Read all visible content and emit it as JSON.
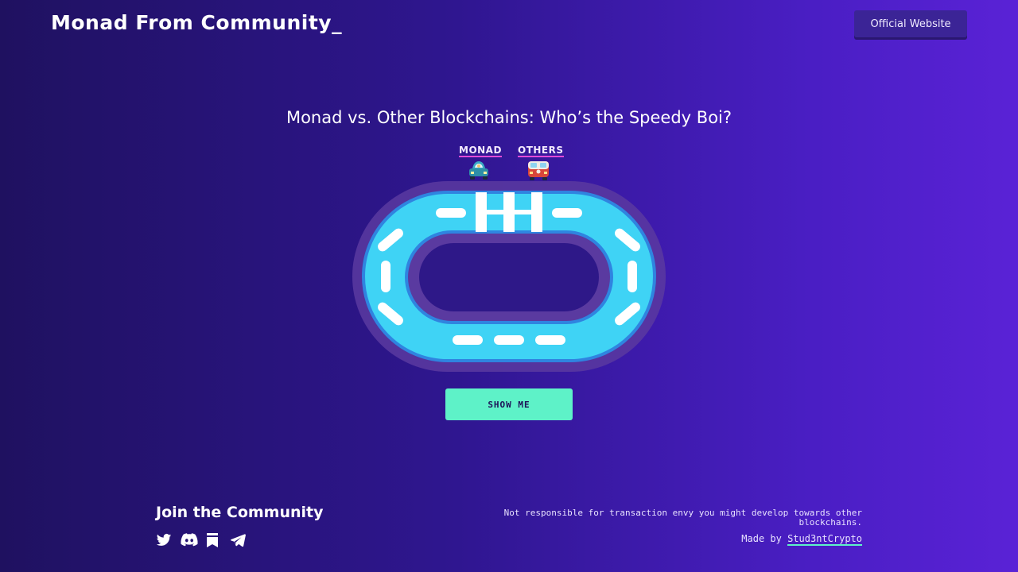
{
  "header": {
    "brand": "Monad From Community_",
    "official_button": "Official Website"
  },
  "main": {
    "heading": "Monad vs. Other Blockchains: Who’s the Speedy Boi?",
    "lanes": [
      {
        "label": "MONAD",
        "car": "car-icon"
      },
      {
        "label": "OTHERS",
        "car": "bus-icon"
      }
    ],
    "show_button": "SHOW ME"
  },
  "footer": {
    "join_title": "Join the Community",
    "socials": [
      "twitter-icon",
      "discord-icon",
      "bookmark-icon",
      "telegram-icon"
    ],
    "disclaimer": "Not responsible for transaction envy you might develop towards other blockchains.",
    "made_by_prefix": "Made by ",
    "made_by_link": "Stud3ntCrypto"
  },
  "colors": {
    "accent": "#5ef2c8",
    "underline": "#e24bd9",
    "track": "#3fd3f5",
    "track_border": "#2f84e0",
    "track_outer": "#5a3aa0",
    "button_dark": "#3b2496"
  }
}
